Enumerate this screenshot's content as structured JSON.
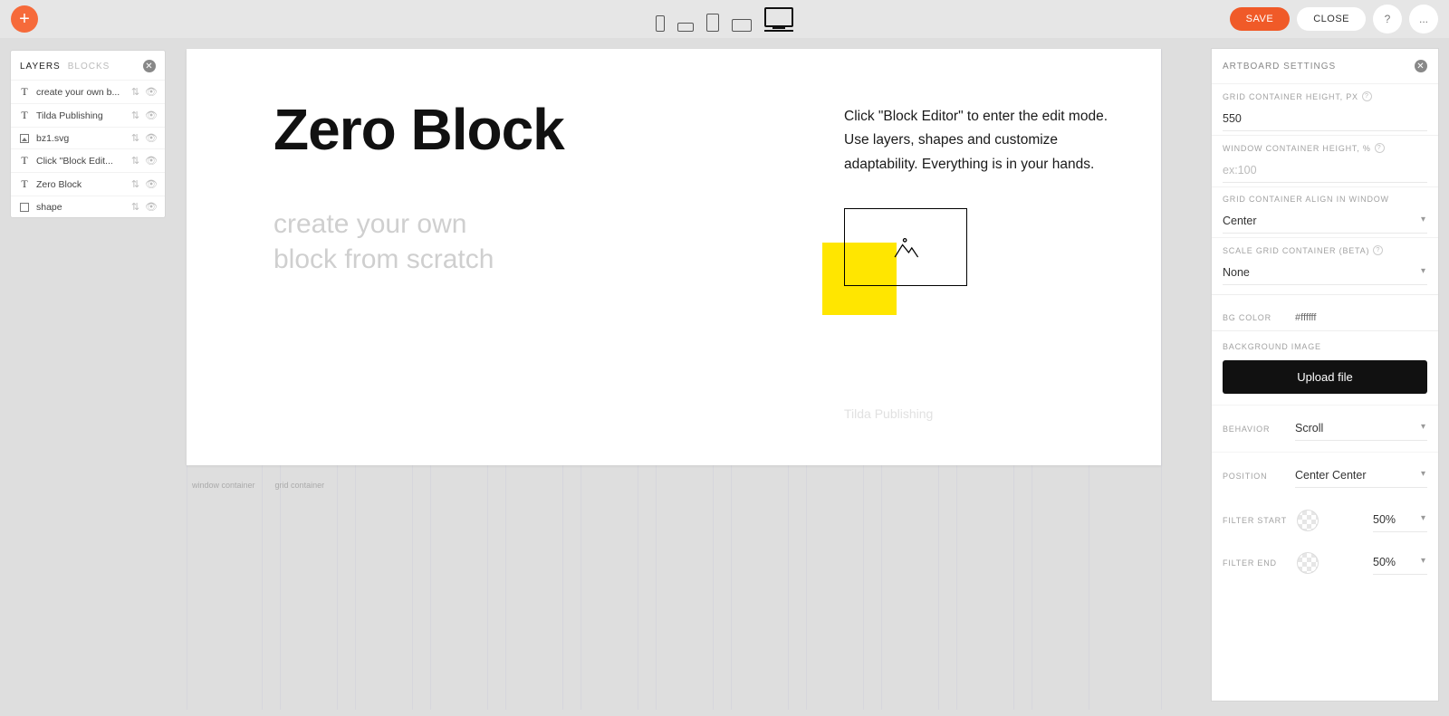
{
  "topbar": {
    "save_label": "SAVE",
    "close_label": "CLOSE",
    "help_label": "?",
    "more_label": "..."
  },
  "layers_panel": {
    "tab_layers": "LAYERS",
    "tab_blocks": "BLOCKS",
    "items": [
      {
        "icon": "T",
        "label": "create your own b..."
      },
      {
        "icon": "T",
        "label": "Tilda Publishing"
      },
      {
        "icon": "img",
        "label": "bz1.svg"
      },
      {
        "icon": "T",
        "label": "Click \"Block Edit..."
      },
      {
        "icon": "T",
        "label": "Zero Block"
      },
      {
        "icon": "shape",
        "label": "shape"
      }
    ]
  },
  "canvas": {
    "title": "Zero Block",
    "subtitle_line1": "create your own",
    "subtitle_line2": "block from scratch",
    "description": "Click \"Block Editor\" to enter the edit mode. Use layers, shapes and customize adaptability. Everything is in your hands.",
    "tilda_text": "Tilda Publishing",
    "window_label": "window container",
    "grid_label": "grid container"
  },
  "settings": {
    "header": "ARTBOARD SETTINGS",
    "grid_height_label": "GRID CONTAINER HEIGHT, PX",
    "grid_height_value": "550",
    "window_height_label": "WINDOW CONTAINER HEIGHT, %",
    "window_height_placeholder": "ex:100",
    "align_label": "GRID CONTAINER ALIGN IN WINDOW",
    "align_value": "Center",
    "scale_label": "SCALE GRID CONTAINER (BETA)",
    "scale_value": "None",
    "bgcolor_label": "BG COLOR",
    "bgcolor_value": "#ffffff",
    "bgimage_label": "BACKGROUND IMAGE",
    "upload_label": "Upload file",
    "behavior_label": "BEHAVIOR",
    "behavior_value": "Scroll",
    "position_label": "POSITION",
    "position_value": "Center Center",
    "filter_start_label": "FILTER START",
    "filter_start_value": "50%",
    "filter_end_label": "FILTER END",
    "filter_end_value": "50%"
  }
}
